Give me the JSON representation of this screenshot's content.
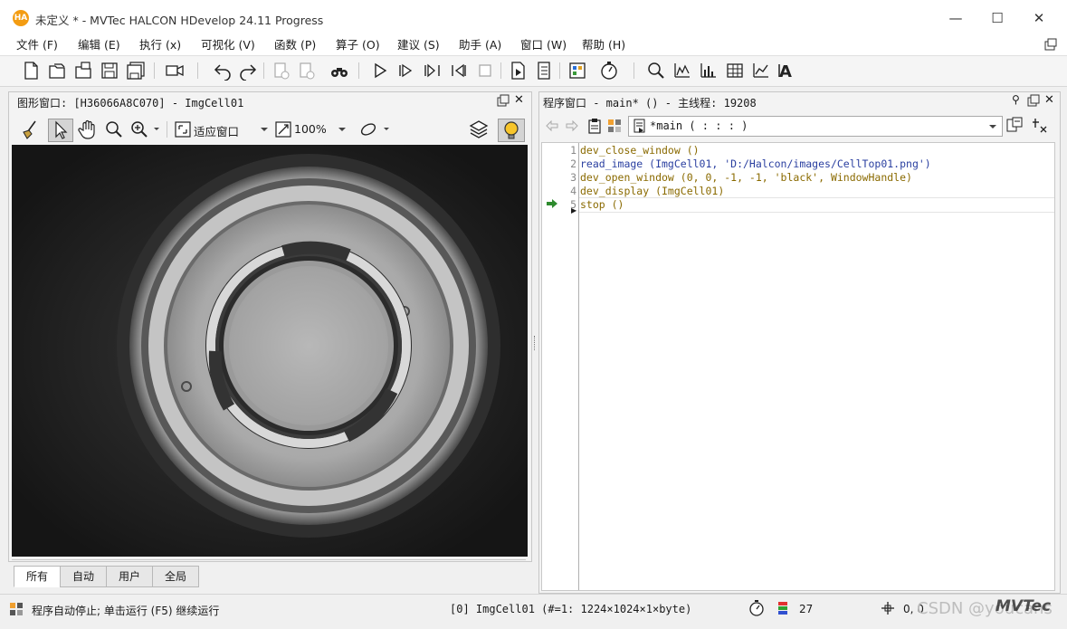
{
  "window": {
    "title": "未定义 * - MVTec HALCON HDevelop 24.11 Progress",
    "logo_text": "HA",
    "minimize": "—",
    "maximize": "☐",
    "close": "✕"
  },
  "menu": [
    {
      "label": "文件 (F)"
    },
    {
      "label": "编辑 (E)"
    },
    {
      "label": "执行 (x)"
    },
    {
      "label": "可视化 (V)"
    },
    {
      "label": "函数 (P)"
    },
    {
      "label": "算子 (O)"
    },
    {
      "label": "建议 (S)"
    },
    {
      "label": "助手 (A)"
    },
    {
      "label": "窗口 (W)"
    },
    {
      "label": "帮助 (H)"
    }
  ],
  "toolbar": {
    "icons": [
      "new-file-icon",
      "open-file-icon",
      "open-example-icon",
      "save-icon",
      "save-all-icon",
      "video-camera-icon",
      "undo-icon",
      "redo-icon",
      "cut-icon",
      "copy-icon",
      "binoculars-icon",
      "run-icon",
      "step-over-icon",
      "step-forward-icon",
      "step-back-icon",
      "stop-icon",
      "reset-program-icon",
      "reset-program-2-icon",
      "variable-inspect-icon",
      "profiler-icon",
      "zoom-window-icon",
      "histogram-icon",
      "line-profile-icon",
      "gray-histogram-icon",
      "feature-histogram-icon",
      "font-icon"
    ]
  },
  "graphics_window": {
    "title": "图形窗口: [H36066A8C070] - ImgCell01",
    "fit_label": "适应窗口",
    "zoom_label": "100%",
    "tabs": [
      {
        "label": "所有"
      },
      {
        "label": "自动"
      },
      {
        "label": "用户"
      },
      {
        "label": "全局"
      }
    ]
  },
  "program_window": {
    "title": "程序窗口 - main* () - 主线程: 19208",
    "procedure": "*main ( : : : )",
    "lines": [
      {
        "n": "1",
        "text": "dev_close_window ()"
      },
      {
        "n": "2",
        "text": "read_image (ImgCell01, 'D:/Halcon/images/CellTop01.png')"
      },
      {
        "n": "3",
        "text": "dev_open_window (0, 0, -1, -1, 'black', WindowHandle)"
      },
      {
        "n": "4",
        "text": "dev_display (ImgCell01)"
      },
      {
        "n": "5",
        "text": "stop ()"
      }
    ]
  },
  "status": {
    "message": "程序自动停止; 单击运行 (F5) 继续运行",
    "image_info": "[0] ImgCell01 (#=1: 1224×1024×1×byte)",
    "gray_value": "27",
    "coords": "0, 0",
    "watermark": "CSDN @youcans",
    "mvtec_logo": "MVTec"
  },
  "colors": {
    "accent_orange": "#f39c12",
    "code_operator": "#8a6a00",
    "code_variable": "#2a3fa0",
    "pc_arrow": "#2e8b2e"
  }
}
